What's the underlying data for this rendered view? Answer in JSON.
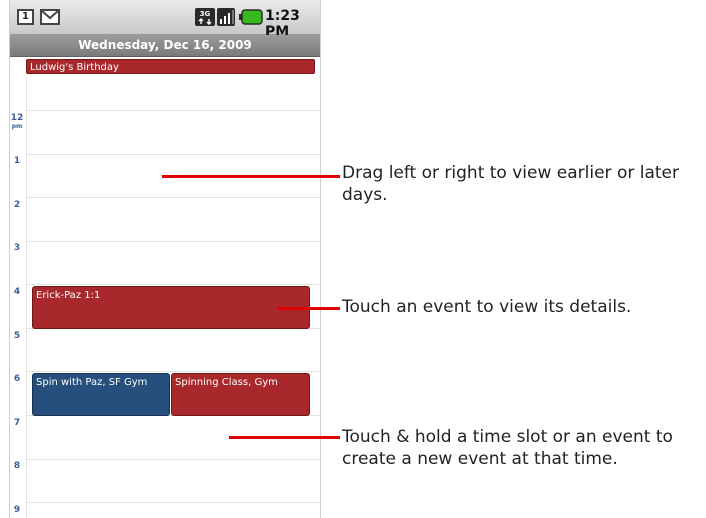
{
  "status_bar": {
    "calendar_notification_label": "1",
    "time": "1:23 PM",
    "icons": [
      "calendar-notification-icon",
      "gmail-notification-icon",
      "3g-data-icon",
      "signal-strength-icon",
      "battery-icon"
    ]
  },
  "date_header": "Wednesday, Dec 16, 2009",
  "all_day_event": "Ludwig's Birthday",
  "hours": [
    {
      "label": "12",
      "sub": "pm"
    },
    {
      "label": "1",
      "sub": ""
    },
    {
      "label": "2",
      "sub": ""
    },
    {
      "label": "3",
      "sub": ""
    },
    {
      "label": "4",
      "sub": ""
    },
    {
      "label": "5",
      "sub": ""
    },
    {
      "label": "6",
      "sub": ""
    },
    {
      "label": "7",
      "sub": ""
    },
    {
      "label": "8",
      "sub": ""
    },
    {
      "label": "9",
      "sub": ""
    }
  ],
  "events": [
    {
      "title": "Erick-Paz 1:1",
      "color": "#a8282c"
    },
    {
      "title": "Spin with Paz, SF Gym",
      "color": "#274f7d"
    },
    {
      "title": "Spinning Class, Gym",
      "color": "#a8282c"
    }
  ],
  "callouts": [
    "Drag left or right to view earlier or later days.",
    "Touch an event to view its details.",
    "Touch & hold a time slot or an event to create a new event at that time."
  ],
  "colors": {
    "callout_line": "#e00000",
    "hour_label": "#3a5f97",
    "header_bg": "#8a8a8a"
  }
}
